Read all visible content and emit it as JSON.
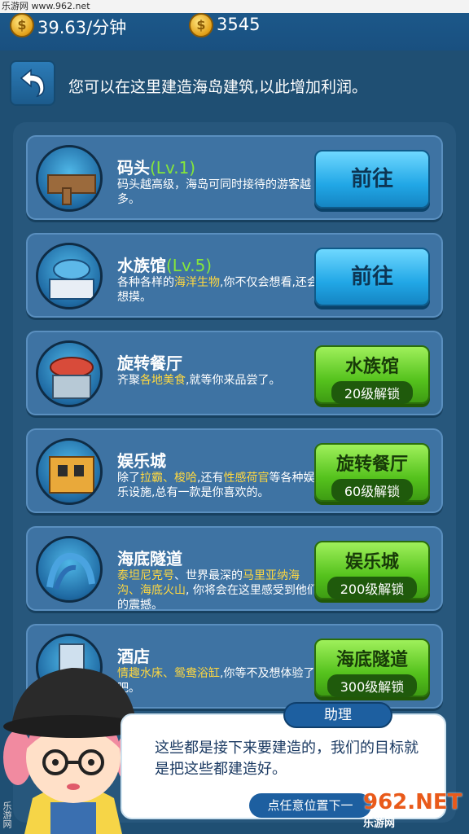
{
  "watermark_top": "乐游网 www.962.net",
  "topbar": {
    "income": "39.63/分钟",
    "gold": "3545"
  },
  "header": {
    "text": "您可以在这里建造海岛建筑,以此增加利润。"
  },
  "cards": [
    {
      "title": "码头",
      "level": "(Lv.1)",
      "desc_parts": [
        {
          "t": "码头越高级，海岛可同时接待的游客越多。"
        }
      ],
      "button": {
        "type": "go",
        "label": "前往"
      }
    },
    {
      "title": "水族馆",
      "level": "(Lv.5)",
      "desc_parts": [
        {
          "t": "各种各样的"
        },
        {
          "t": "海洋生物",
          "hl": true
        },
        {
          "t": ",你不仅会想看,还会想摸。"
        }
      ],
      "button": {
        "type": "go",
        "label": "前往"
      }
    },
    {
      "title": "旋转餐厅",
      "level": "",
      "desc_parts": [
        {
          "t": "齐聚"
        },
        {
          "t": "各地美食",
          "hl": true
        },
        {
          "t": ",就等你来品尝了。"
        }
      ],
      "button": {
        "type": "lock",
        "label": "水族馆",
        "sub": "20级解锁"
      }
    },
    {
      "title": "娱乐城",
      "level": "",
      "desc_parts": [
        {
          "t": "除了"
        },
        {
          "t": "拉霸、梭哈",
          "hl": true
        },
        {
          "t": ",还有"
        },
        {
          "t": "性感荷官",
          "hl": true
        },
        {
          "t": "等各种娱乐设施,总有一款是你喜欢的。"
        }
      ],
      "button": {
        "type": "lock",
        "label": "旋转餐厅",
        "sub": "60级解锁"
      }
    },
    {
      "title": "海底隧道",
      "level": "",
      "desc_parts": [
        {
          "t": "泰坦尼克号",
          "hl": true
        },
        {
          "t": "、世界最深的"
        },
        {
          "t": "马里亚纳海沟、海底火山",
          "hl": true
        },
        {
          "t": ", 你将会在这里感受到他们的震撼。"
        }
      ],
      "button": {
        "type": "lock",
        "label": "娱乐城",
        "sub": "200级解锁"
      }
    },
    {
      "title": "酒店",
      "level": "",
      "desc_parts": [
        {
          "t": "情趣水床、鸳鸯浴缸",
          "hl": true
        },
        {
          "t": ",你等不及想体验了吧。"
        }
      ],
      "button": {
        "type": "lock",
        "label": "海底隧道",
        "sub": "300级解锁"
      }
    }
  ],
  "assistant": {
    "name": "助理",
    "text": "这些都是接下来要建造的，我们的目标就是把这些都建造好。",
    "tap_label": "点任意位置下一"
  },
  "watermark_br": {
    "big": "962.NET",
    "small": "乐游网"
  },
  "watermark_left": "乐游网"
}
